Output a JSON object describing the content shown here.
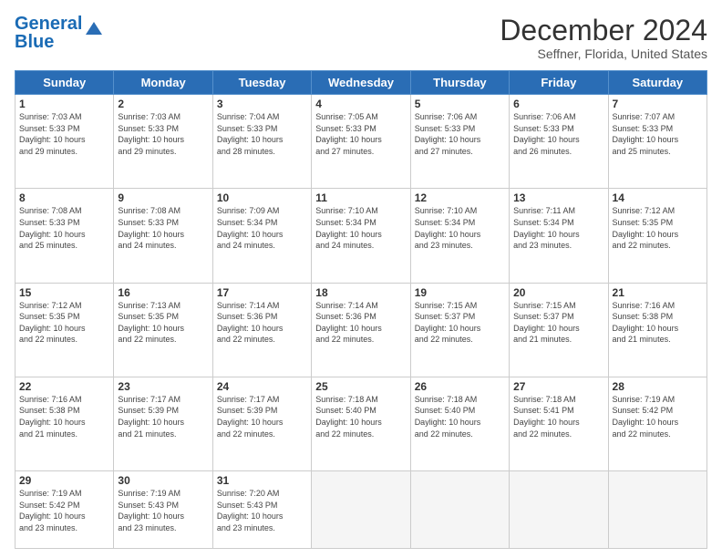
{
  "header": {
    "logo_line1": "General",
    "logo_line2": "Blue",
    "month": "December 2024",
    "location": "Seffner, Florida, United States"
  },
  "days_of_week": [
    "Sunday",
    "Monday",
    "Tuesday",
    "Wednesday",
    "Thursday",
    "Friday",
    "Saturday"
  ],
  "weeks": [
    [
      {
        "day": "1",
        "info": "Sunrise: 7:03 AM\nSunset: 5:33 PM\nDaylight: 10 hours\nand 29 minutes."
      },
      {
        "day": "2",
        "info": "Sunrise: 7:03 AM\nSunset: 5:33 PM\nDaylight: 10 hours\nand 29 minutes."
      },
      {
        "day": "3",
        "info": "Sunrise: 7:04 AM\nSunset: 5:33 PM\nDaylight: 10 hours\nand 28 minutes."
      },
      {
        "day": "4",
        "info": "Sunrise: 7:05 AM\nSunset: 5:33 PM\nDaylight: 10 hours\nand 27 minutes."
      },
      {
        "day": "5",
        "info": "Sunrise: 7:06 AM\nSunset: 5:33 PM\nDaylight: 10 hours\nand 27 minutes."
      },
      {
        "day": "6",
        "info": "Sunrise: 7:06 AM\nSunset: 5:33 PM\nDaylight: 10 hours\nand 26 minutes."
      },
      {
        "day": "7",
        "info": "Sunrise: 7:07 AM\nSunset: 5:33 PM\nDaylight: 10 hours\nand 25 minutes."
      }
    ],
    [
      {
        "day": "8",
        "info": "Sunrise: 7:08 AM\nSunset: 5:33 PM\nDaylight: 10 hours\nand 25 minutes."
      },
      {
        "day": "9",
        "info": "Sunrise: 7:08 AM\nSunset: 5:33 PM\nDaylight: 10 hours\nand 24 minutes."
      },
      {
        "day": "10",
        "info": "Sunrise: 7:09 AM\nSunset: 5:34 PM\nDaylight: 10 hours\nand 24 minutes."
      },
      {
        "day": "11",
        "info": "Sunrise: 7:10 AM\nSunset: 5:34 PM\nDaylight: 10 hours\nand 24 minutes."
      },
      {
        "day": "12",
        "info": "Sunrise: 7:10 AM\nSunset: 5:34 PM\nDaylight: 10 hours\nand 23 minutes."
      },
      {
        "day": "13",
        "info": "Sunrise: 7:11 AM\nSunset: 5:34 PM\nDaylight: 10 hours\nand 23 minutes."
      },
      {
        "day": "14",
        "info": "Sunrise: 7:12 AM\nSunset: 5:35 PM\nDaylight: 10 hours\nand 22 minutes."
      }
    ],
    [
      {
        "day": "15",
        "info": "Sunrise: 7:12 AM\nSunset: 5:35 PM\nDaylight: 10 hours\nand 22 minutes."
      },
      {
        "day": "16",
        "info": "Sunrise: 7:13 AM\nSunset: 5:35 PM\nDaylight: 10 hours\nand 22 minutes."
      },
      {
        "day": "17",
        "info": "Sunrise: 7:14 AM\nSunset: 5:36 PM\nDaylight: 10 hours\nand 22 minutes."
      },
      {
        "day": "18",
        "info": "Sunrise: 7:14 AM\nSunset: 5:36 PM\nDaylight: 10 hours\nand 22 minutes."
      },
      {
        "day": "19",
        "info": "Sunrise: 7:15 AM\nSunset: 5:37 PM\nDaylight: 10 hours\nand 22 minutes."
      },
      {
        "day": "20",
        "info": "Sunrise: 7:15 AM\nSunset: 5:37 PM\nDaylight: 10 hours\nand 21 minutes."
      },
      {
        "day": "21",
        "info": "Sunrise: 7:16 AM\nSunset: 5:38 PM\nDaylight: 10 hours\nand 21 minutes."
      }
    ],
    [
      {
        "day": "22",
        "info": "Sunrise: 7:16 AM\nSunset: 5:38 PM\nDaylight: 10 hours\nand 21 minutes."
      },
      {
        "day": "23",
        "info": "Sunrise: 7:17 AM\nSunset: 5:39 PM\nDaylight: 10 hours\nand 21 minutes."
      },
      {
        "day": "24",
        "info": "Sunrise: 7:17 AM\nSunset: 5:39 PM\nDaylight: 10 hours\nand 22 minutes."
      },
      {
        "day": "25",
        "info": "Sunrise: 7:18 AM\nSunset: 5:40 PM\nDaylight: 10 hours\nand 22 minutes."
      },
      {
        "day": "26",
        "info": "Sunrise: 7:18 AM\nSunset: 5:40 PM\nDaylight: 10 hours\nand 22 minutes."
      },
      {
        "day": "27",
        "info": "Sunrise: 7:18 AM\nSunset: 5:41 PM\nDaylight: 10 hours\nand 22 minutes."
      },
      {
        "day": "28",
        "info": "Sunrise: 7:19 AM\nSunset: 5:42 PM\nDaylight: 10 hours\nand 22 minutes."
      }
    ],
    [
      {
        "day": "29",
        "info": "Sunrise: 7:19 AM\nSunset: 5:42 PM\nDaylight: 10 hours\nand 23 minutes."
      },
      {
        "day": "30",
        "info": "Sunrise: 7:19 AM\nSunset: 5:43 PM\nDaylight: 10 hours\nand 23 minutes."
      },
      {
        "day": "31",
        "info": "Sunrise: 7:20 AM\nSunset: 5:43 PM\nDaylight: 10 hours\nand 23 minutes."
      },
      {
        "day": "",
        "info": ""
      },
      {
        "day": "",
        "info": ""
      },
      {
        "day": "",
        "info": ""
      },
      {
        "day": "",
        "info": ""
      }
    ]
  ]
}
